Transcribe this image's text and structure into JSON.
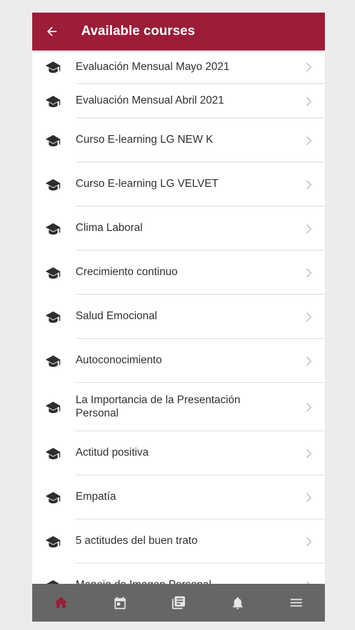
{
  "header": {
    "title": "Available courses",
    "back_icon": "arrow-left-icon",
    "background": "#9b1d38"
  },
  "courses": [
    {
      "label": "Evaluación Mensual Mayo 2021",
      "icon": "graduation-cap-icon"
    },
    {
      "label": "Evaluación Mensual Abril 2021",
      "icon": "graduation-cap-icon"
    },
    {
      "label": "Curso E-learning LG NEW K",
      "icon": "graduation-cap-icon"
    },
    {
      "label": "Curso E-learning LG VELVET",
      "icon": "graduation-cap-icon"
    },
    {
      "label": "Clima Laboral",
      "icon": "graduation-cap-icon"
    },
    {
      "label": "Crecimiento continuo",
      "icon": "graduation-cap-icon"
    },
    {
      "label": "Salud Emocional",
      "icon": "graduation-cap-icon"
    },
    {
      "label": "Autoconocimiento",
      "icon": "graduation-cap-icon"
    },
    {
      "label": "La Importancia de la Presentación Personal",
      "icon": "graduation-cap-icon"
    },
    {
      "label": "Actitud positiva",
      "icon": "graduation-cap-icon"
    },
    {
      "label": "Empatía",
      "icon": "graduation-cap-icon"
    },
    {
      "label": "5 actitudes del buen trato",
      "icon": "graduation-cap-icon"
    },
    {
      "label": "Manejo de Imagen Personal",
      "icon": "graduation-cap-icon"
    }
  ],
  "bottom_nav": {
    "items": [
      {
        "name": "home",
        "icon": "home-icon",
        "active": true
      },
      {
        "name": "calendar",
        "icon": "calendar-icon",
        "active": false
      },
      {
        "name": "messages",
        "icon": "messages-icon",
        "active": false
      },
      {
        "name": "notifications",
        "icon": "bell-icon",
        "active": false
      },
      {
        "name": "menu",
        "icon": "menu-icon",
        "active": false
      }
    ],
    "active_color": "#9b1d38",
    "inactive_color": "#e8e8e8",
    "background": "#666666"
  }
}
